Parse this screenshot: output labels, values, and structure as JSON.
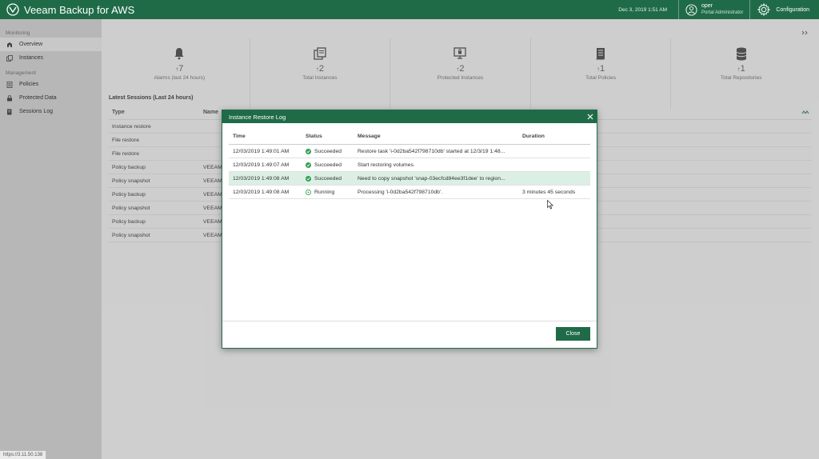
{
  "app": {
    "title": "Veeam Backup for AWS",
    "datetime": "Dec 3, 2019 1:51 AM",
    "user_name": "oper",
    "user_role": "Portal Administrator",
    "config_label": "Configuration"
  },
  "sidebar": {
    "monitoring_label": "Monitoring",
    "management_label": "Management",
    "monitoring_items": [
      {
        "label": "Overview",
        "icon": "overview-icon",
        "active": true
      },
      {
        "label": "Instances",
        "icon": "instances-icon"
      }
    ],
    "management_items": [
      {
        "label": "Policies",
        "icon": "policies-icon"
      },
      {
        "label": "Protected Data",
        "icon": "lock-icon"
      },
      {
        "label": "Sessions Log",
        "icon": "sessions-log-icon"
      }
    ]
  },
  "stats": [
    {
      "value": "7",
      "label": "Alarms (last 24 hours)",
      "icon": "bell-icon"
    },
    {
      "value": "2",
      "label": "Total Instances",
      "icon": "instances-icon"
    },
    {
      "value": "2",
      "label": "Protected Instances",
      "icon": "protected-icon"
    },
    {
      "value": "1",
      "label": "Total Policies",
      "icon": "policies-icon"
    },
    {
      "value": "1",
      "label": "Total Repositories",
      "icon": "repository-icon"
    }
  ],
  "sessions": {
    "title": "Latest Sessions (Last 24 hours)",
    "columns": [
      "Type",
      "Name"
    ],
    "rows": [
      {
        "type": "Instance restore",
        "name": ""
      },
      {
        "type": "File restore",
        "name": ""
      },
      {
        "type": "File restore",
        "name": ""
      },
      {
        "type": "Policy backup",
        "name": "VEEAM"
      },
      {
        "type": "Policy snapshot",
        "name": "VEEAM"
      },
      {
        "type": "Policy backup",
        "name": "VEEAM"
      },
      {
        "type": "Policy snapshot",
        "name": "VEEAM"
      },
      {
        "type": "Policy backup",
        "name": "VEEAM"
      },
      {
        "type": "Policy snapshot",
        "name": "VEEAM"
      }
    ]
  },
  "dialog": {
    "title": "Instance Restore Log",
    "columns": {
      "time": "Time",
      "status": "Status",
      "message": "Message",
      "duration": "Duration"
    },
    "rows": [
      {
        "time": "12/03/2019 1:49:01 AM",
        "status": "Succeeded",
        "message": "Restore task 'i-0d2ba542f798710db' started at 12/3/19 1:48...",
        "duration": ""
      },
      {
        "time": "12/03/2019 1:49:07 AM",
        "status": "Succeeded",
        "message": "Start restoring volumes.",
        "duration": ""
      },
      {
        "time": "12/03/2019 1:49:08 AM",
        "status": "Succeeded",
        "message": "Need to copy snapshot 'snap-03ecfcd84ee3f1dee' to region...",
        "duration": ""
      },
      {
        "time": "12/03/2019 1:49:08 AM",
        "status": "Running",
        "message": "Processing 'i-0d2ba542f798710db'.",
        "duration": "3 minutes 45 seconds"
      }
    ],
    "highlighted_row": 2,
    "close_label": "Close"
  },
  "status_bar": {
    "url": "https://3.11.50.138"
  },
  "colors": {
    "brand": "#1f6b48",
    "success": "#2e9e52",
    "highlight": "#dcefe5"
  }
}
